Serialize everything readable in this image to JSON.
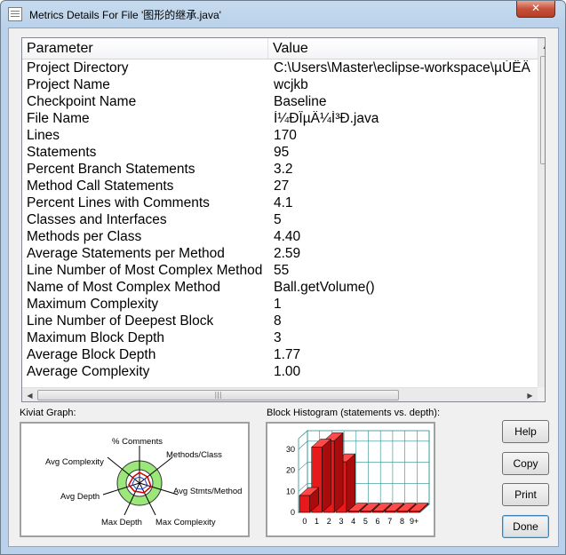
{
  "window": {
    "title": "Metrics Details For File '图形的继承.java'",
    "close_label": "✕"
  },
  "table": {
    "headers": [
      "Parameter",
      "Value"
    ],
    "rows": [
      {
        "param": "Project Directory",
        "value": "C:\\Users\\Master\\eclipse-workspace\\µÚËÄ"
      },
      {
        "param": "Project Name",
        "value": "wcjkb"
      },
      {
        "param": "Checkpoint Name",
        "value": "Baseline"
      },
      {
        "param": "File Name",
        "value": "Í¼ÐÎµÄ¼Ì³Ð.java"
      },
      {
        "param": "Lines",
        "value": "170"
      },
      {
        "param": "Statements",
        "value": "95"
      },
      {
        "param": "Percent Branch Statements",
        "value": "3.2"
      },
      {
        "param": "Method Call Statements",
        "value": "27"
      },
      {
        "param": "Percent Lines with Comments",
        "value": "4.1"
      },
      {
        "param": "Classes and Interfaces",
        "value": "5"
      },
      {
        "param": "Methods per Class",
        "value": "4.40"
      },
      {
        "param": "Average Statements per Method",
        "value": "2.59"
      },
      {
        "param": "Line Number of Most Complex Method",
        "value": "55"
      },
      {
        "param": "Name of Most Complex Method",
        "value": "Ball.getVolume()"
      },
      {
        "param": "Maximum Complexity",
        "value": "1"
      },
      {
        "param": "Line Number of Deepest Block",
        "value": "8"
      },
      {
        "param": "Maximum Block Depth",
        "value": "3"
      },
      {
        "param": "Average Block Depth",
        "value": "1.77"
      },
      {
        "param": "Average Complexity",
        "value": "1.00"
      }
    ]
  },
  "kiviat": {
    "label": "Kiviat Graph:",
    "axes": [
      "% Comments",
      "Methods/Class",
      "Avg Stmts/Method",
      "Max Complexity",
      "Max Depth",
      "Avg Depth",
      "Avg Complexity"
    ]
  },
  "histogram": {
    "label": "Block Histogram (statements vs. depth):",
    "y_ticks": [
      "0",
      "10",
      "20",
      "30"
    ],
    "x_labels": [
      "0",
      "1",
      "2",
      "3",
      "4",
      "5",
      "6",
      "7",
      "8",
      "9+"
    ]
  },
  "chart_data": {
    "type": "bar",
    "categories": [
      "0",
      "1",
      "2",
      "3",
      "4",
      "5",
      "6",
      "7",
      "8",
      "9+"
    ],
    "values": [
      8,
      31,
      34,
      24,
      0,
      0,
      0,
      0,
      0,
      0
    ],
    "title": "Block Histogram (statements vs. depth):",
    "xlabel": "",
    "ylabel": "",
    "ylim": [
      0,
      35
    ],
    "grid": true
  },
  "buttons": {
    "help": "Help",
    "copy": "Copy",
    "print": "Print",
    "done": "Done"
  },
  "colors": {
    "bar": "#e8191b",
    "kiviat_band": "#9be77a"
  }
}
